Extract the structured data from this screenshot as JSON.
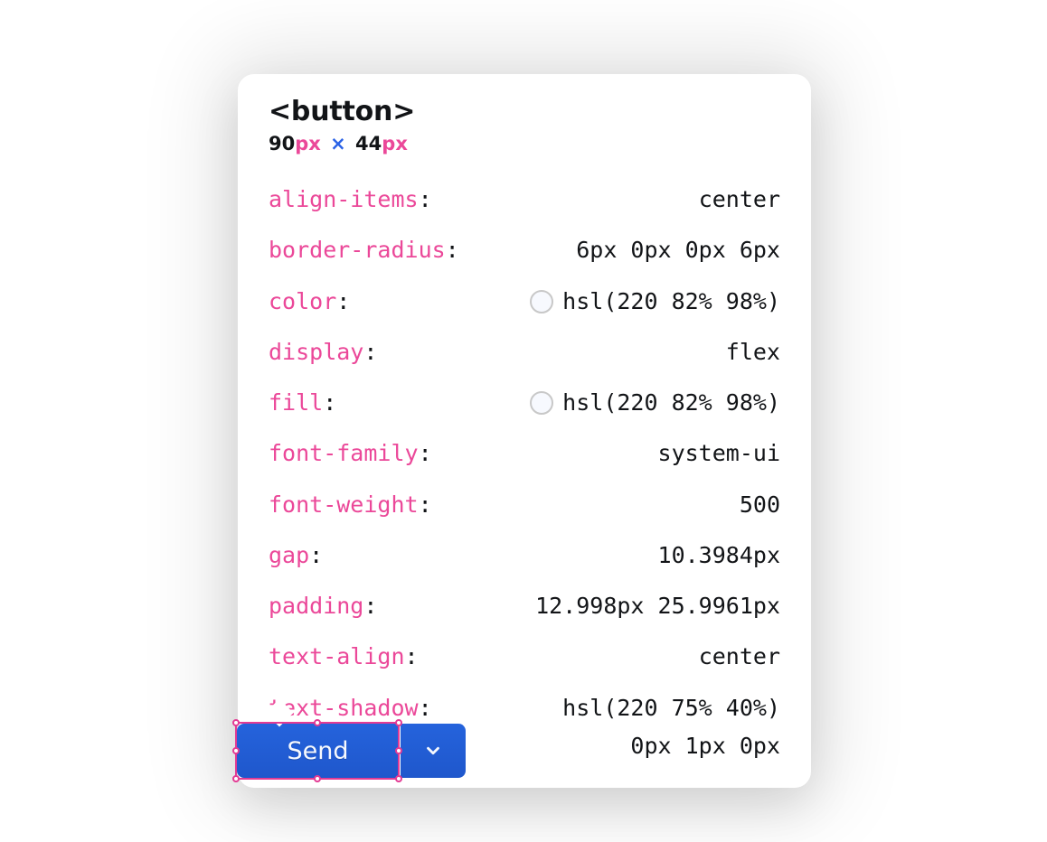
{
  "tooltip": {
    "element_tag": "<button>",
    "dimensions": {
      "width_num": "90",
      "width_unit": "px",
      "separator": "×",
      "height_num": "44",
      "height_unit": "px"
    },
    "properties": [
      {
        "name": "align-items",
        "value": "center",
        "swatch": false
      },
      {
        "name": "border-radius",
        "value": "6px 0px 0px 6px",
        "swatch": false
      },
      {
        "name": "color",
        "value": "hsl(220 82% 98%)",
        "swatch": true
      },
      {
        "name": "display",
        "value": "flex",
        "swatch": false
      },
      {
        "name": "fill",
        "value": "hsl(220 82% 98%)",
        "swatch": true
      },
      {
        "name": "font-family",
        "value": "system-ui",
        "swatch": false
      },
      {
        "name": "font-weight",
        "value": "500",
        "swatch": false
      },
      {
        "name": "gap",
        "value": "10.3984px",
        "swatch": false
      },
      {
        "name": "padding",
        "value": "12.998px 25.9961px",
        "swatch": false
      },
      {
        "name": "text-align",
        "value": "center",
        "swatch": false
      },
      {
        "name": "text-shadow",
        "value_lines": [
          "hsl(220 75% 40%)",
          "0px 1px 0px"
        ],
        "swatch": false
      }
    ]
  },
  "button_group": {
    "send_label": "Send"
  }
}
